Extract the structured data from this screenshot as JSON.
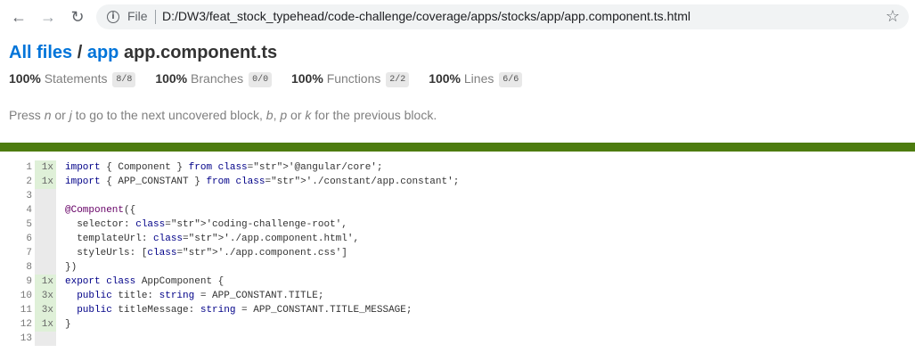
{
  "browser": {
    "file_label": "File",
    "url": "D:/DW3/feat_stock_typehead/code-challenge/coverage/apps/stocks/app/app.component.ts.html",
    "back_icon": "arrow-left",
    "forward_icon": "arrow-right",
    "reload_icon": "reload",
    "info_icon": "info-circle",
    "star_icon": "star-outline"
  },
  "header": {
    "crumb_all": "All files",
    "crumb_sep": "/",
    "crumb_app": "app",
    "file_name": "app.component.ts"
  },
  "stats": [
    {
      "pct": "100%",
      "label": "Statements",
      "fraction": "8/8"
    },
    {
      "pct": "100%",
      "label": "Branches",
      "fraction": "0/0"
    },
    {
      "pct": "100%",
      "label": "Functions",
      "fraction": "2/2"
    },
    {
      "pct": "100%",
      "label": "Lines",
      "fraction": "6/6"
    }
  ],
  "hint": {
    "p1": "Press ",
    "k_n": "n",
    "p2": " or ",
    "k_j": "j",
    "p3": " to go to the next uncovered block, ",
    "k_b": "b",
    "p4": ", ",
    "k_p": "p",
    "p5": " or ",
    "k_k": "k",
    "p6": " for the previous block."
  },
  "colors": {
    "status_bar": "#4d7c0f",
    "link": "#0074D9",
    "covered_bg": "#dff0d8"
  },
  "code_lines": [
    {
      "n": "1",
      "hits": "1x",
      "code": "import { Component } from '@angular/core';"
    },
    {
      "n": "2",
      "hits": "1x",
      "code": "import { APP_CONSTANT } from './constant/app.constant';"
    },
    {
      "n": "3",
      "hits": "",
      "code": ""
    },
    {
      "n": "4",
      "hits": "",
      "code": "@Component({"
    },
    {
      "n": "5",
      "hits": "",
      "code": "  selector: 'coding-challenge-root',"
    },
    {
      "n": "6",
      "hits": "",
      "code": "  templateUrl: './app.component.html',"
    },
    {
      "n": "7",
      "hits": "",
      "code": "  styleUrls: ['./app.component.css']"
    },
    {
      "n": "8",
      "hits": "",
      "code": "})"
    },
    {
      "n": "9",
      "hits": "1x",
      "code": "export class AppComponent {"
    },
    {
      "n": "10",
      "hits": "3x",
      "code": "  public title: string = APP_CONSTANT.TITLE;"
    },
    {
      "n": "11",
      "hits": "3x",
      "code": "  public titleMessage: string = APP_CONSTANT.TITLE_MESSAGE;"
    },
    {
      "n": "12",
      "hits": "1x",
      "code": "}"
    },
    {
      "n": "13",
      "hits": "",
      "code": ""
    }
  ]
}
